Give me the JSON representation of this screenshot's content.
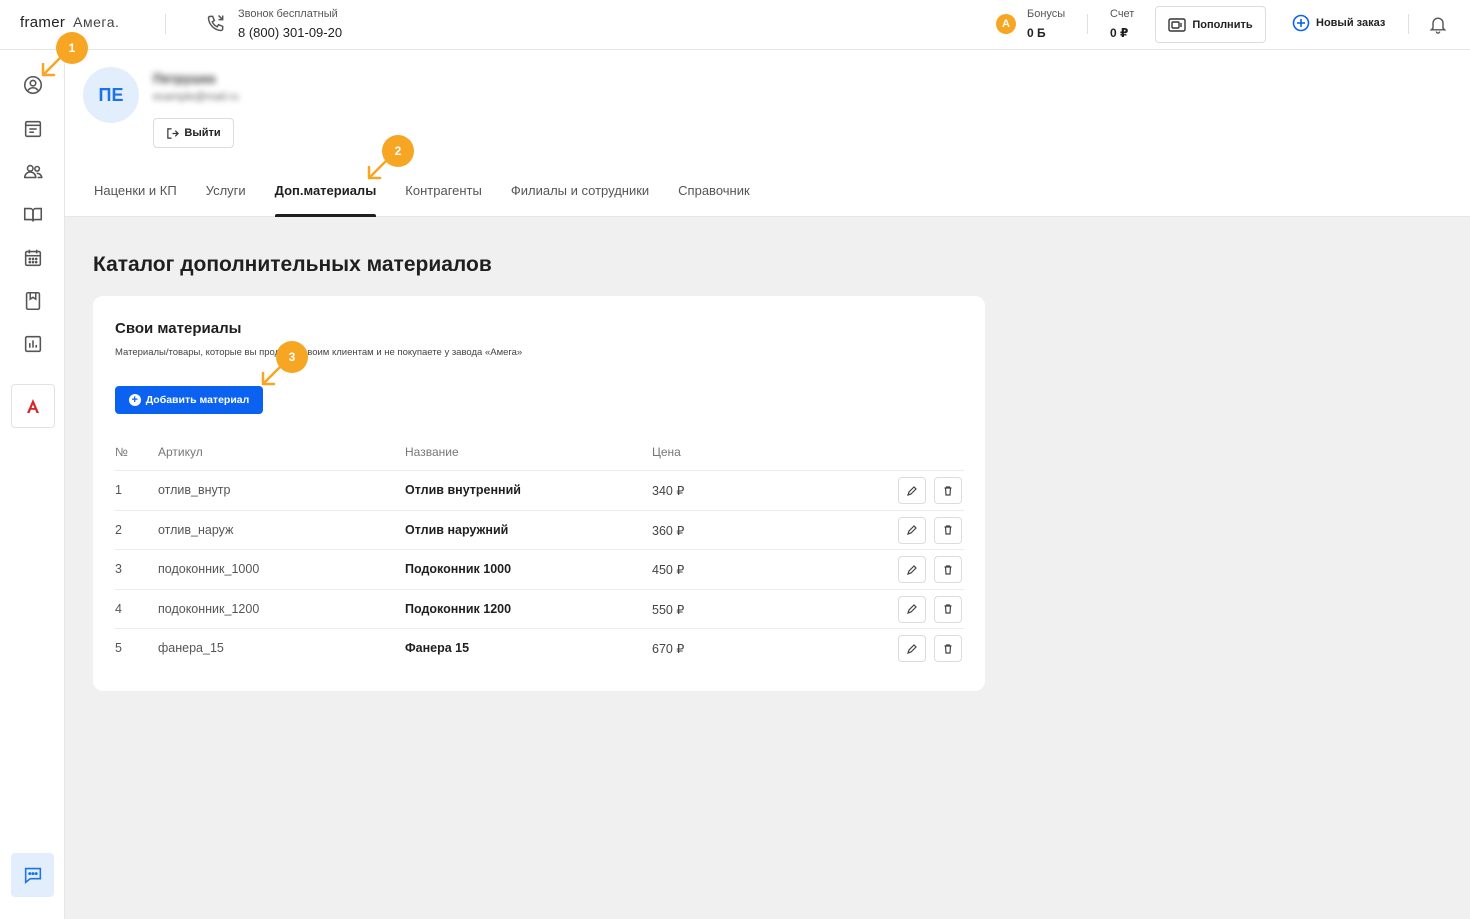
{
  "header": {
    "logo_framer": "framer",
    "logo_amega": "Амега.",
    "phone_label": "Звонок бесплатный",
    "phone_number": "8 (800) 301-09-20",
    "bonus_label": "Бонусы",
    "bonus_value": "0 Б",
    "bonus_coin": "A",
    "account_label": "Счет",
    "account_value": "0 ₽",
    "topup_label": "Пополнить",
    "new_order_label": "Новый заказ"
  },
  "profile": {
    "initials": "ПЕ",
    "name": "Петрушка",
    "email": "example@mail.ru",
    "logout_label": "Выйти"
  },
  "tabs": [
    {
      "label": "Наценки и КП",
      "active": false
    },
    {
      "label": "Услуги",
      "active": false
    },
    {
      "label": "Доп.материалы",
      "active": true
    },
    {
      "label": "Контрагенты",
      "active": false
    },
    {
      "label": "Филиалы и сотрудники",
      "active": false
    },
    {
      "label": "Справочник",
      "active": false
    }
  ],
  "main": {
    "page_title": "Каталог дополнительных материалов",
    "card_title": "Свои материалы",
    "card_desc": "Материалы/товары, которые вы продаете своим клиентам и не покупаете у завода «Амега»",
    "add_button": "Добавить материал"
  },
  "table": {
    "headers": {
      "num": "№",
      "article": "Артикул",
      "name": "Название",
      "price": "Цена"
    },
    "rows": [
      {
        "num": "1",
        "article": "отлив_внутр",
        "name": "Отлив внутренний",
        "price": "340 ₽"
      },
      {
        "num": "2",
        "article": "отлив_наруж",
        "name": "Отлив наружний",
        "price": "360 ₽"
      },
      {
        "num": "3",
        "article": "подоконник_1000",
        "name": "Подоконник 1000",
        "price": "450 ₽"
      },
      {
        "num": "4",
        "article": "подоконник_1200",
        "name": "Подоконник 1200",
        "price": "550 ₽"
      },
      {
        "num": "5",
        "article": "фанера_15",
        "name": "Фанера 15",
        "price": "670 ₽"
      }
    ]
  },
  "callouts": [
    "1",
    "2",
    "3"
  ],
  "colors": {
    "accent_blue": "#0b62f0",
    "callout_orange": "#f6a623",
    "avatar_bg": "#e3eefc",
    "brand_red": "#d6262c"
  },
  "icons": {
    "sidebar": [
      "profile-icon",
      "orders-icon",
      "clients-icon",
      "catalog-book-icon",
      "calendar-icon",
      "bookmark-icon",
      "analytics-icon"
    ],
    "header": [
      "phone-icon",
      "wallet-icon",
      "plus-circle-icon",
      "bell-icon"
    ],
    "row_actions": [
      "pencil-icon",
      "trash-icon"
    ]
  }
}
